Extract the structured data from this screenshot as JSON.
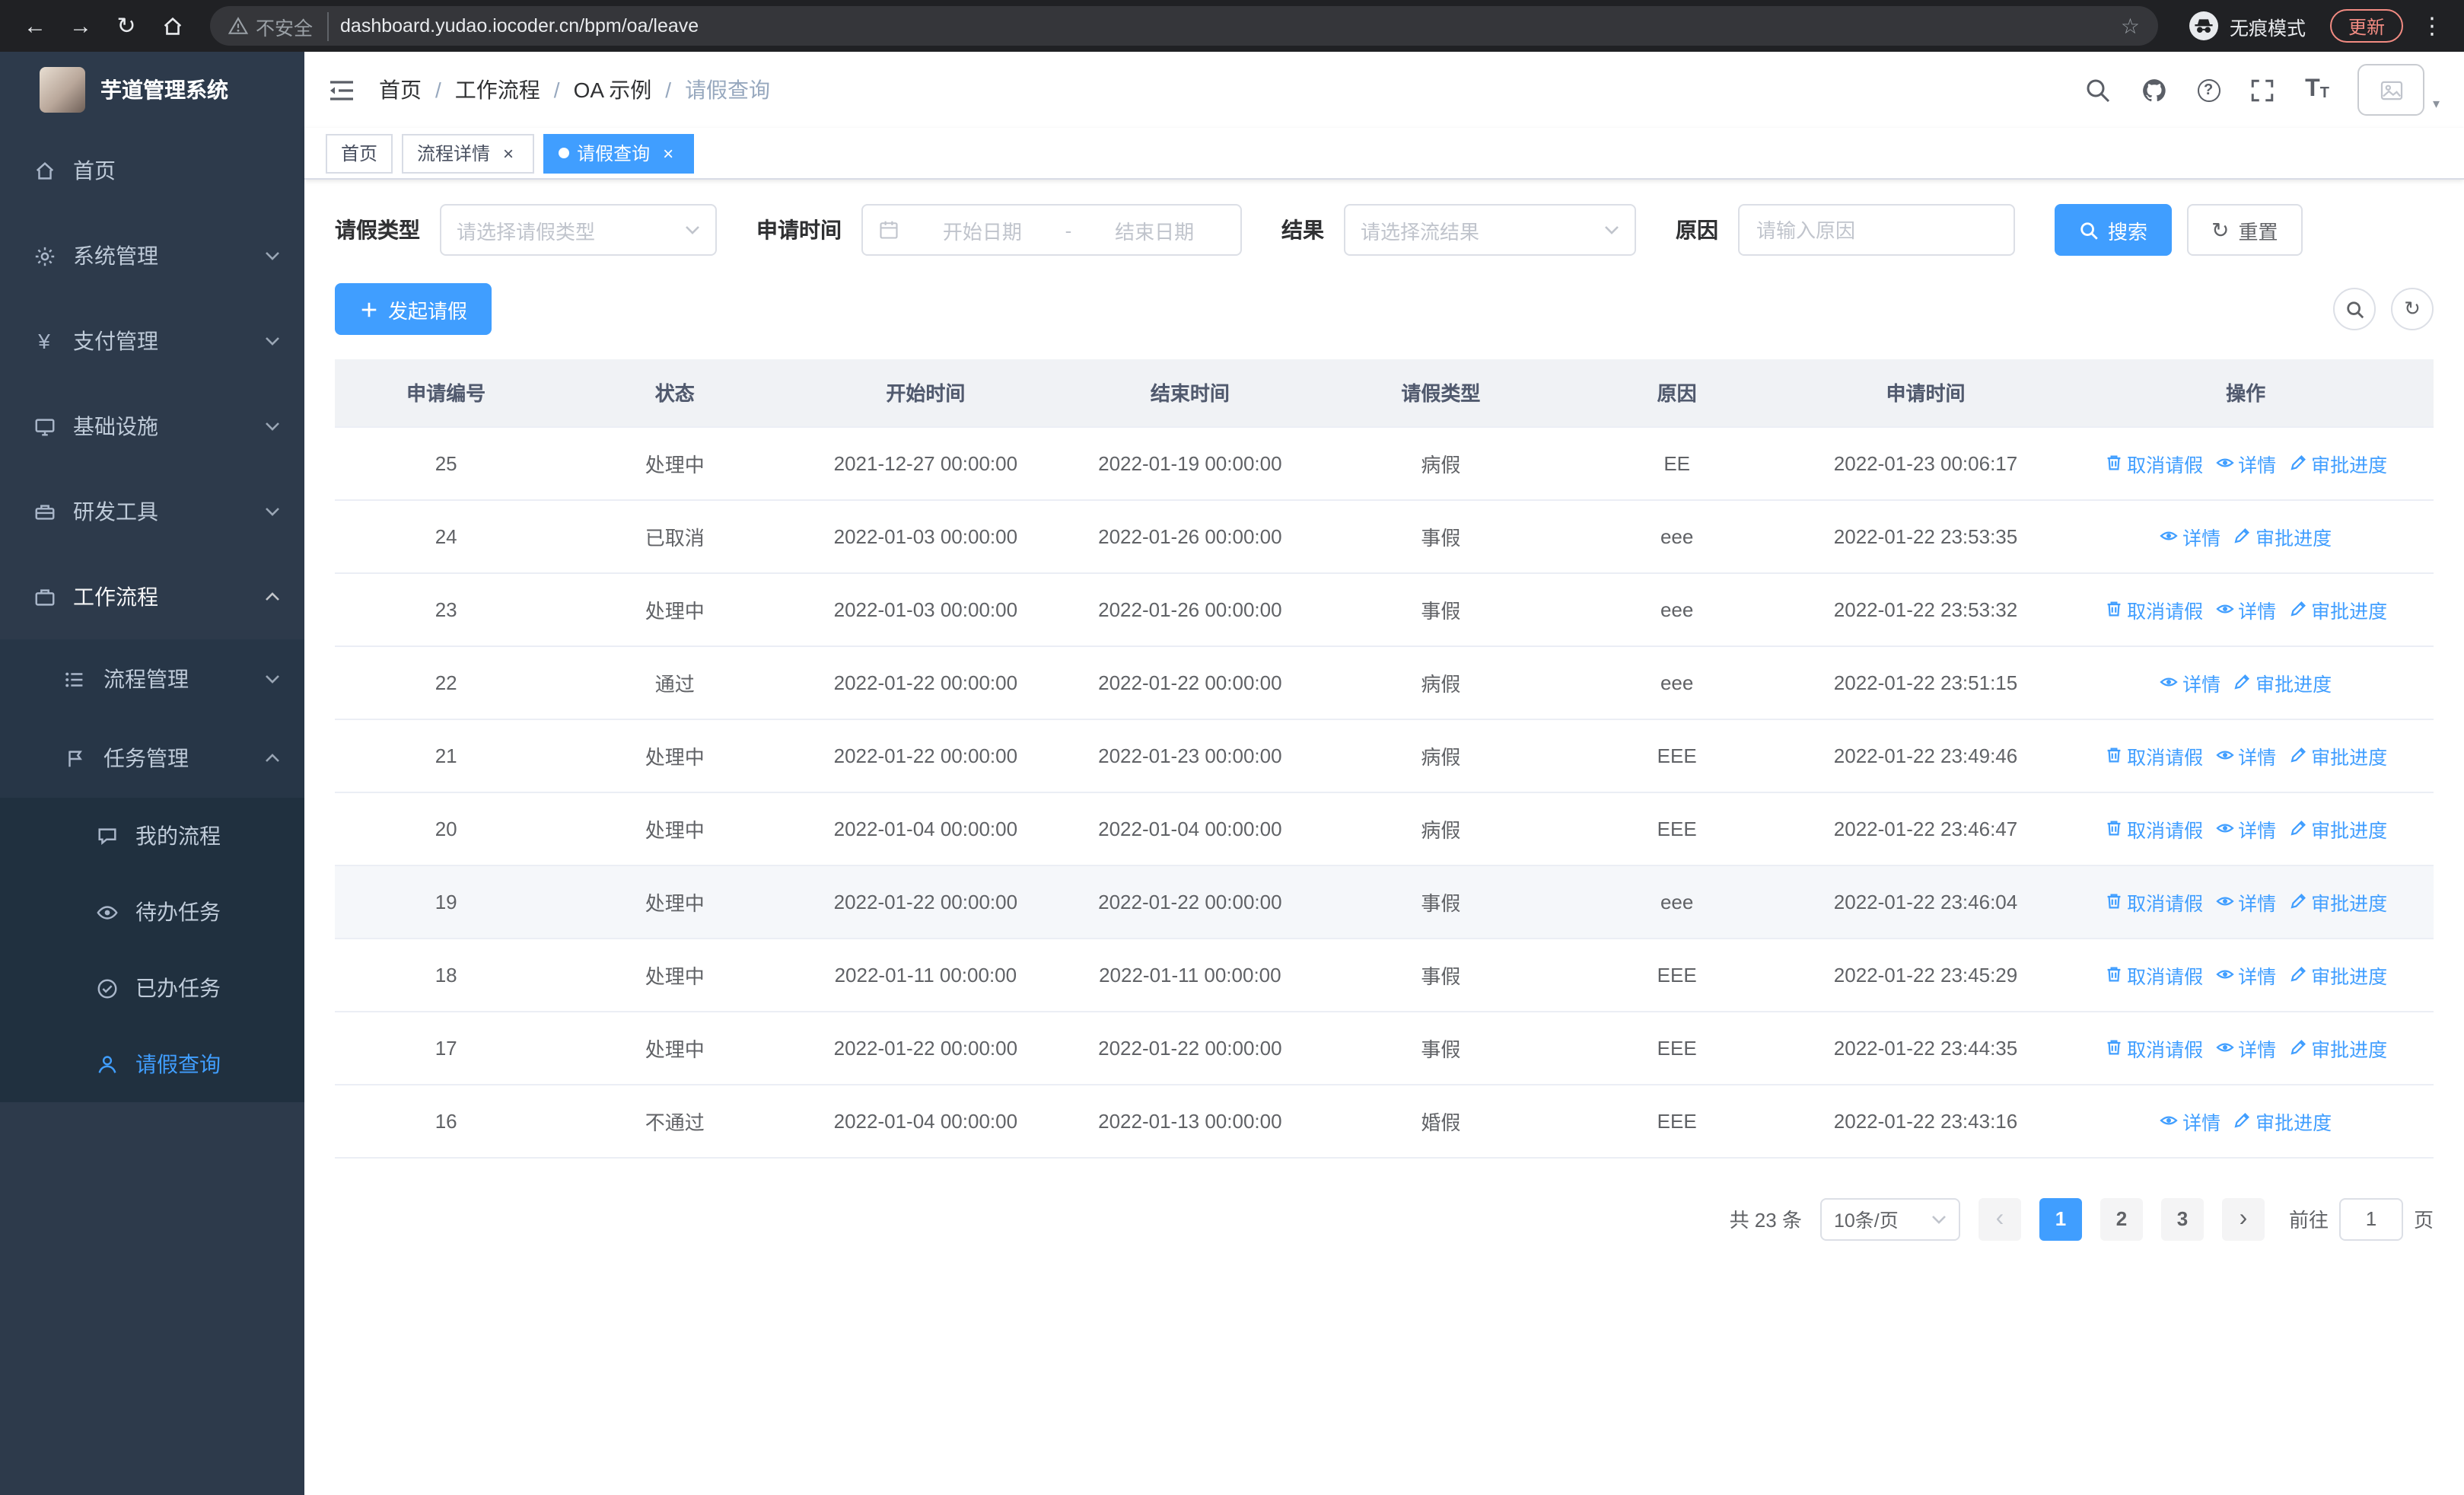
{
  "theme": {
    "accent": "#409eff",
    "sidebar_bg": "#2d3a4b"
  },
  "browser": {
    "security_label": "不安全",
    "url": "dashboard.yudao.iocoder.cn/bpm/oa/leave",
    "incognito_label": "无痕模式",
    "update_label": "更新"
  },
  "sidebar": {
    "title": "芋道管理系统",
    "menu": [
      {
        "label": "首页"
      },
      {
        "label": "系统管理"
      },
      {
        "label": "支付管理"
      },
      {
        "label": "基础设施"
      },
      {
        "label": "研发工具"
      },
      {
        "label": "工作流程",
        "children": [
          {
            "label": "流程管理"
          },
          {
            "label": "任务管理",
            "children": [
              {
                "label": "我的流程"
              },
              {
                "label": "待办任务"
              },
              {
                "label": "已办任务"
              },
              {
                "label": "请假查询"
              }
            ]
          }
        ]
      }
    ]
  },
  "header": {
    "breadcrumb": [
      "首页",
      "工作流程",
      "OA 示例",
      "请假查询"
    ]
  },
  "tabs": [
    {
      "label": "首页"
    },
    {
      "label": "流程详情"
    },
    {
      "label": "请假查询"
    }
  ],
  "filters": {
    "leave_type": {
      "label": "请假类型",
      "placeholder": "请选择请假类型"
    },
    "apply_time": {
      "label": "申请时间",
      "start_placeholder": "开始日期",
      "separator": "-",
      "end_placeholder": "结束日期"
    },
    "result": {
      "label": "结果",
      "placeholder": "请选择流结果"
    },
    "reason": {
      "label": "原因",
      "placeholder": "请输入原因"
    },
    "search_label": "搜索",
    "reset_label": "重置"
  },
  "toolbar": {
    "create_label": "发起请假"
  },
  "table": {
    "columns": [
      "申请编号",
      "状态",
      "开始时间",
      "结束时间",
      "请假类型",
      "原因",
      "申请时间",
      "操作"
    ],
    "action_labels": {
      "cancel": "取消请假",
      "detail": "详情",
      "progress": "审批进度"
    },
    "rows": [
      {
        "id": "25",
        "status": "处理中",
        "start": "2021-12-27 00:00:00",
        "end": "2022-01-19 00:00:00",
        "type": "病假",
        "reason": "EE",
        "applied": "2022-01-23 00:06:17",
        "actions": [
          "cancel",
          "detail",
          "progress"
        ],
        "highlight": false
      },
      {
        "id": "24",
        "status": "已取消",
        "start": "2022-01-03 00:00:00",
        "end": "2022-01-26 00:00:00",
        "type": "事假",
        "reason": "eee",
        "applied": "2022-01-22 23:53:35",
        "actions": [
          "detail",
          "progress"
        ],
        "highlight": false
      },
      {
        "id": "23",
        "status": "处理中",
        "start": "2022-01-03 00:00:00",
        "end": "2022-01-26 00:00:00",
        "type": "事假",
        "reason": "eee",
        "applied": "2022-01-22 23:53:32",
        "actions": [
          "cancel",
          "detail",
          "progress"
        ],
        "highlight": false
      },
      {
        "id": "22",
        "status": "通过",
        "start": "2022-01-22 00:00:00",
        "end": "2022-01-22 00:00:00",
        "type": "病假",
        "reason": "eee",
        "applied": "2022-01-22 23:51:15",
        "actions": [
          "detail",
          "progress"
        ],
        "highlight": false
      },
      {
        "id": "21",
        "status": "处理中",
        "start": "2022-01-22 00:00:00",
        "end": "2022-01-23 00:00:00",
        "type": "病假",
        "reason": "EEE",
        "applied": "2022-01-22 23:49:46",
        "actions": [
          "cancel",
          "detail",
          "progress"
        ],
        "highlight": false
      },
      {
        "id": "20",
        "status": "处理中",
        "start": "2022-01-04 00:00:00",
        "end": "2022-01-04 00:00:00",
        "type": "病假",
        "reason": "EEE",
        "applied": "2022-01-22 23:46:47",
        "actions": [
          "cancel",
          "detail",
          "progress"
        ],
        "highlight": false
      },
      {
        "id": "19",
        "status": "处理中",
        "start": "2022-01-22 00:00:00",
        "end": "2022-01-22 00:00:00",
        "type": "事假",
        "reason": "eee",
        "applied": "2022-01-22 23:46:04",
        "actions": [
          "cancel",
          "detail",
          "progress"
        ],
        "highlight": true
      },
      {
        "id": "18",
        "status": "处理中",
        "start": "2022-01-11 00:00:00",
        "end": "2022-01-11 00:00:00",
        "type": "事假",
        "reason": "EEE",
        "applied": "2022-01-22 23:45:29",
        "actions": [
          "cancel",
          "detail",
          "progress"
        ],
        "highlight": false
      },
      {
        "id": "17",
        "status": "处理中",
        "start": "2022-01-22 00:00:00",
        "end": "2022-01-22 00:00:00",
        "type": "事假",
        "reason": "EEE",
        "applied": "2022-01-22 23:44:35",
        "actions": [
          "cancel",
          "detail",
          "progress"
        ],
        "highlight": false
      },
      {
        "id": "16",
        "status": "不通过",
        "start": "2022-01-04 00:00:00",
        "end": "2022-01-13 00:00:00",
        "type": "婚假",
        "reason": "EEE",
        "applied": "2022-01-22 23:43:16",
        "actions": [
          "detail",
          "progress"
        ],
        "highlight": false
      }
    ]
  },
  "pagination": {
    "total_label": "共 23 条",
    "page_size": "10条/页",
    "pages": [
      "1",
      "2",
      "3"
    ],
    "active_page": "1",
    "goto_label": "前往",
    "goto_value": "1",
    "page_unit": "页"
  }
}
